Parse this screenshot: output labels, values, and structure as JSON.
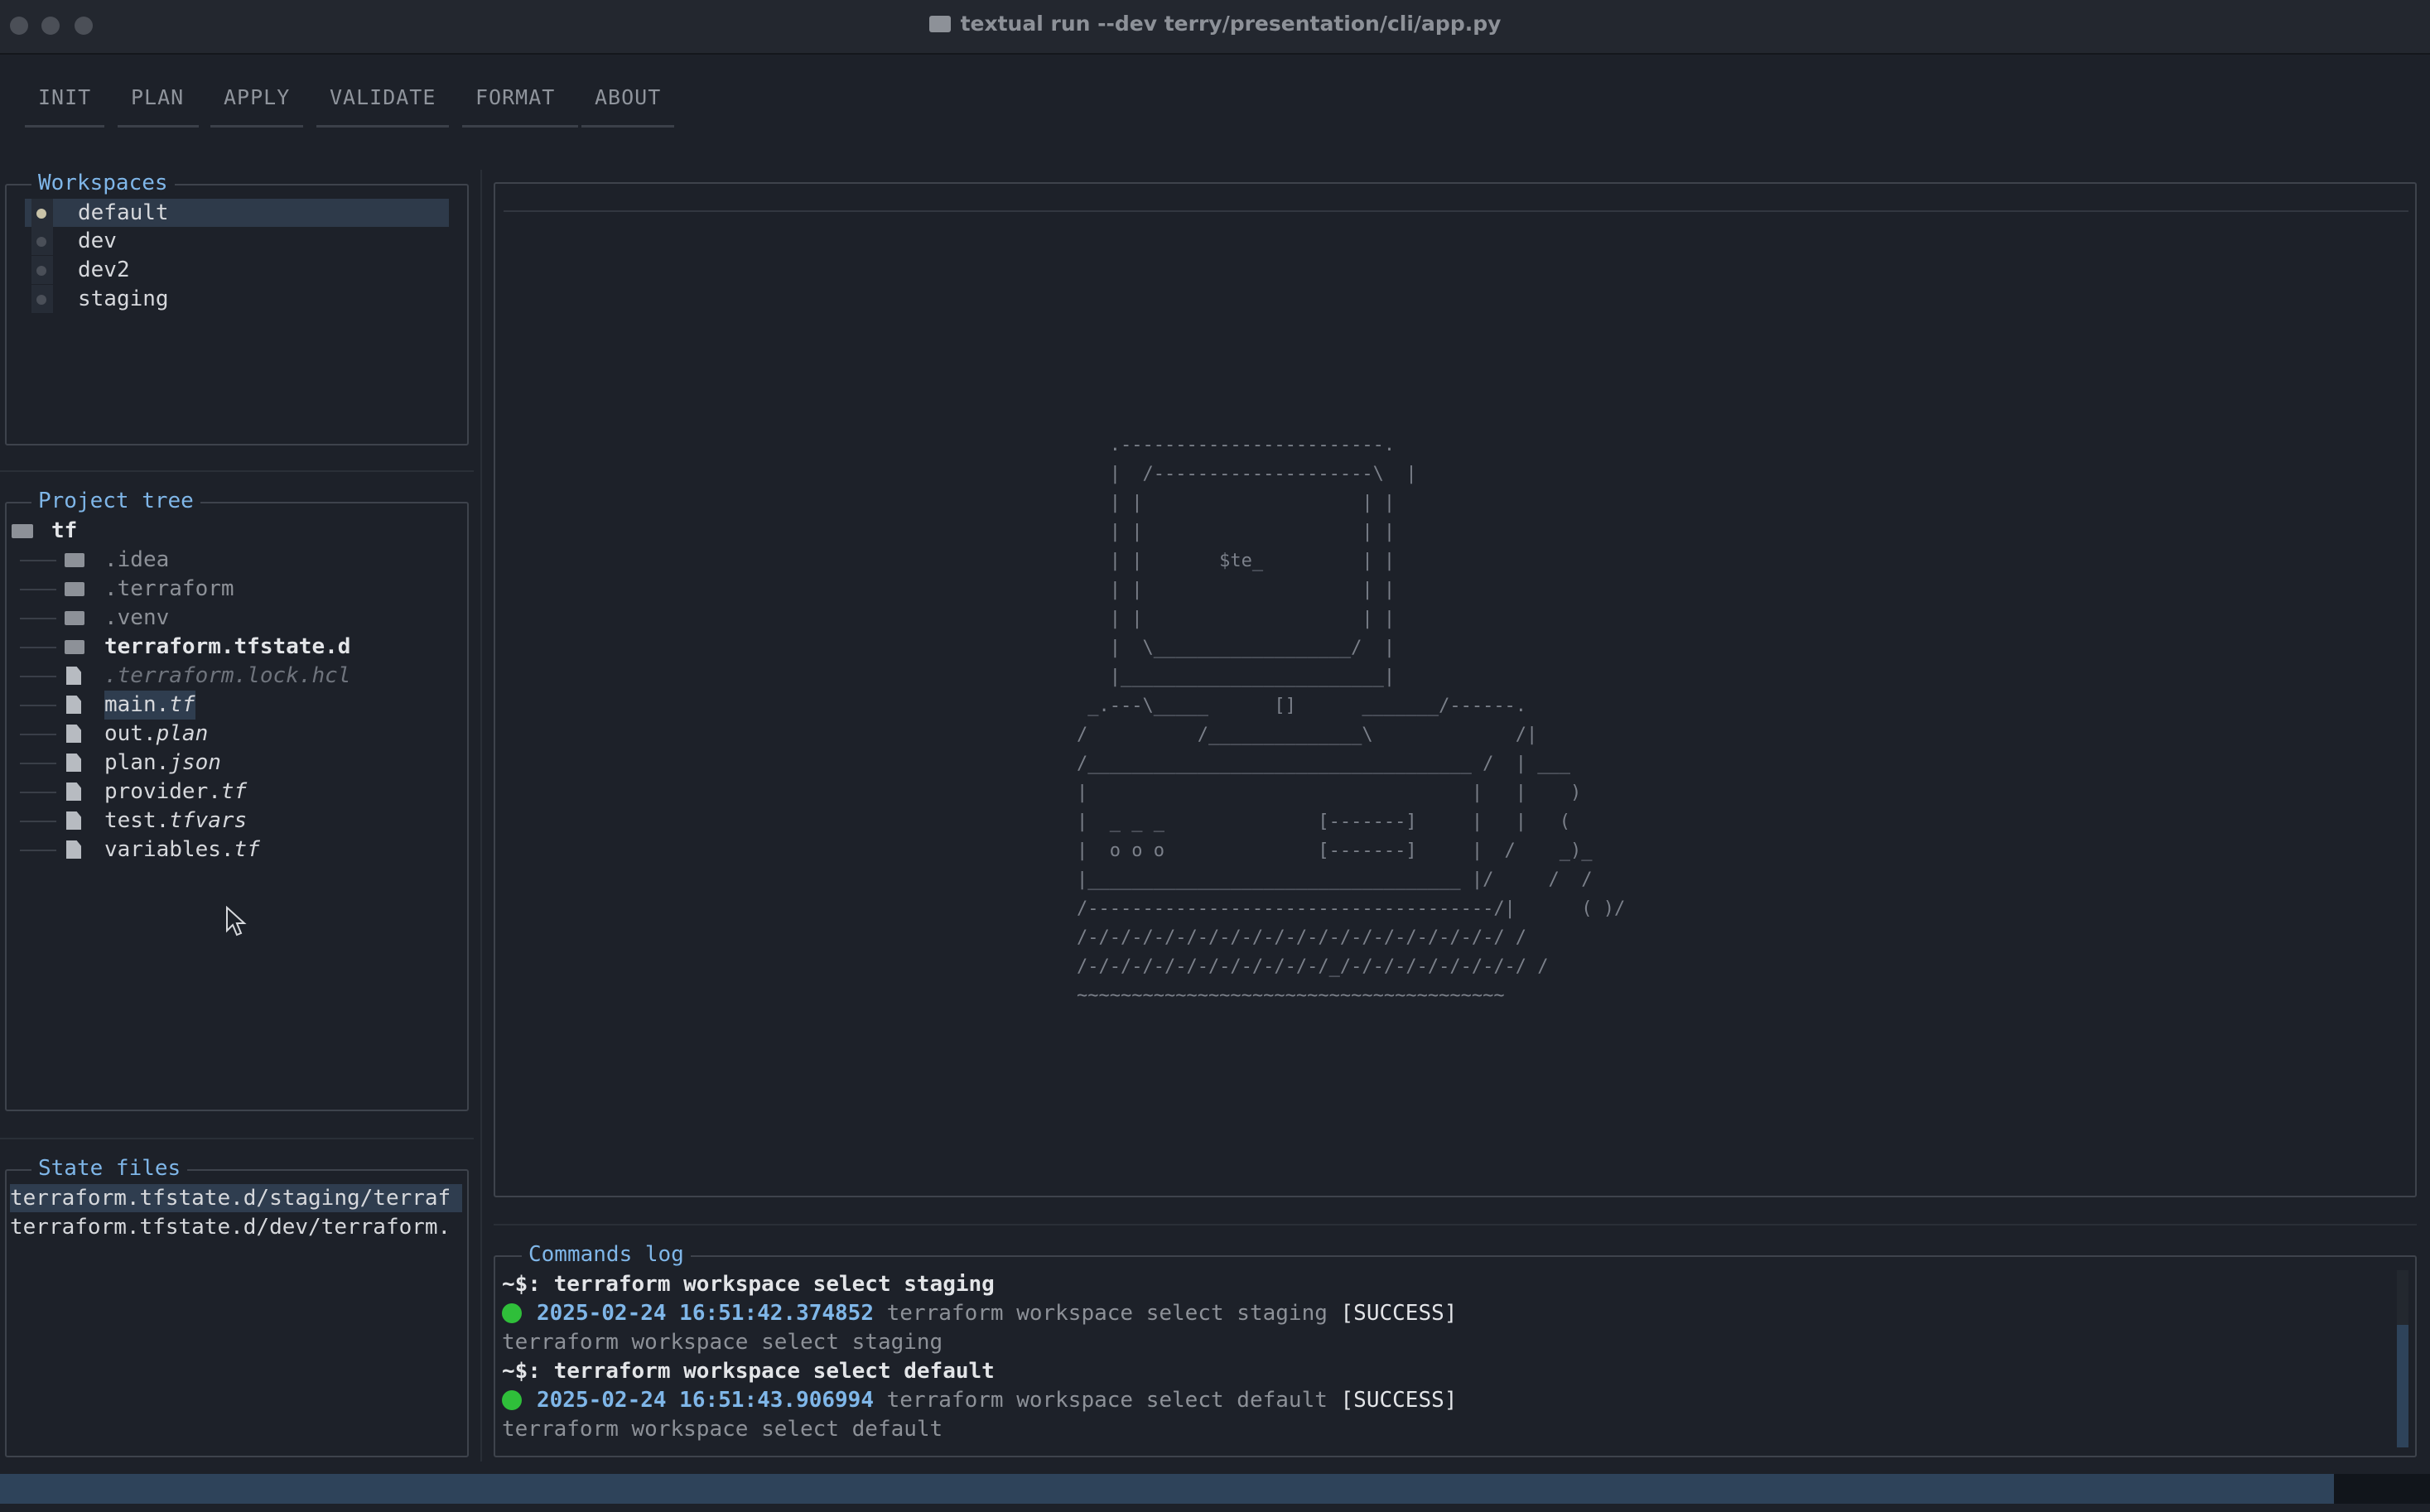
{
  "window": {
    "title": "textual run --dev terry/presentation/cli/app.py"
  },
  "tabs": [
    "INIT",
    "PLAN",
    "APPLY",
    "VALIDATE",
    "FORMAT",
    "ABOUT"
  ],
  "workspaces": {
    "title": "Workspaces",
    "items": [
      "default",
      "dev",
      "dev2",
      "staging"
    ],
    "selected": "default"
  },
  "project_tree": {
    "title": "Project tree",
    "root": "tf",
    "items": [
      {
        "name": ".idea",
        "ext": "",
        "kind": "folder"
      },
      {
        "name": ".terraform",
        "ext": "",
        "kind": "folder"
      },
      {
        "name": ".venv",
        "ext": "",
        "kind": "folder"
      },
      {
        "name": "terraform.tfstate.d",
        "ext": "",
        "kind": "folder"
      },
      {
        "name": ".terraform.lock.hcl",
        "ext": "",
        "kind": "file"
      },
      {
        "name": "main.",
        "ext": "tf",
        "kind": "file"
      },
      {
        "name": "out.",
        "ext": "plan",
        "kind": "file"
      },
      {
        "name": "plan.",
        "ext": "json",
        "kind": "file"
      },
      {
        "name": "provider.",
        "ext": "tf",
        "kind": "file"
      },
      {
        "name": "test.",
        "ext": "tfvars",
        "kind": "file"
      },
      {
        "name": "variables.",
        "ext": "tf",
        "kind": "file"
      }
    ]
  },
  "state_files": {
    "title": "State files",
    "items": [
      "terraform.tfstate.d/staging/terraf",
      "terraform.tfstate.d/dev/terraform."
    ]
  },
  "ascii_art": "   .------------------------.\n   |  /--------------------\\  |\n   | |                    | |\n   | |                    | |\n   | |       $te_         | |\n   | |                    | |\n   | |                    | |\n   |  \\__________________/  |\n   |________________________|\n _.---\\_____      []      _______/------.\n/          /______________\\             /|\n/___________________________________ /  | ___\n|                                   |   |    )\n|  _ _ _              [-------]     |   |   (\n|  o o o              [-------]     |  /    _)_\n|__________________________________ |/     /  /\n/-------------------------------------/|      ( )/\n/-/-/-/-/-/-/-/-/-/-/-/-/-/-/-/-/-/-/-/ /\n/-/-/-/-/-/-/-/-/-/-/-/_/-/-/-/-/-/-/-/-/ /\n~~~~~~~~~~~~~~~~~~~~~~~~~~~~~~~~~~~~~~~",
  "commands_log": {
    "title": "Commands log",
    "entries": [
      {
        "command": "~$: terraform workspace select staging",
        "timestamp": "2025-02-24 16:51:42.374852",
        "message": "terraform workspace select staging",
        "status": "[SUCCESS]",
        "output": "terraform workspace select staging"
      },
      {
        "command": "~$: terraform workspace select default",
        "timestamp": "2025-02-24 16:51:43.906994",
        "message": "terraform workspace select default",
        "status": "[SUCCESS]",
        "output": "terraform workspace select default"
      }
    ]
  },
  "icons": {
    "folder": "folder-icon",
    "file": "file-icon",
    "cursor": "mouse-cursor-icon",
    "success": "success-dot-icon"
  },
  "colors": {
    "background": "#1d2129",
    "accent": "#7fb6e8",
    "selection": "#2e3a4a",
    "success": "#2fbf3a",
    "statusbar": "#2e435a"
  }
}
